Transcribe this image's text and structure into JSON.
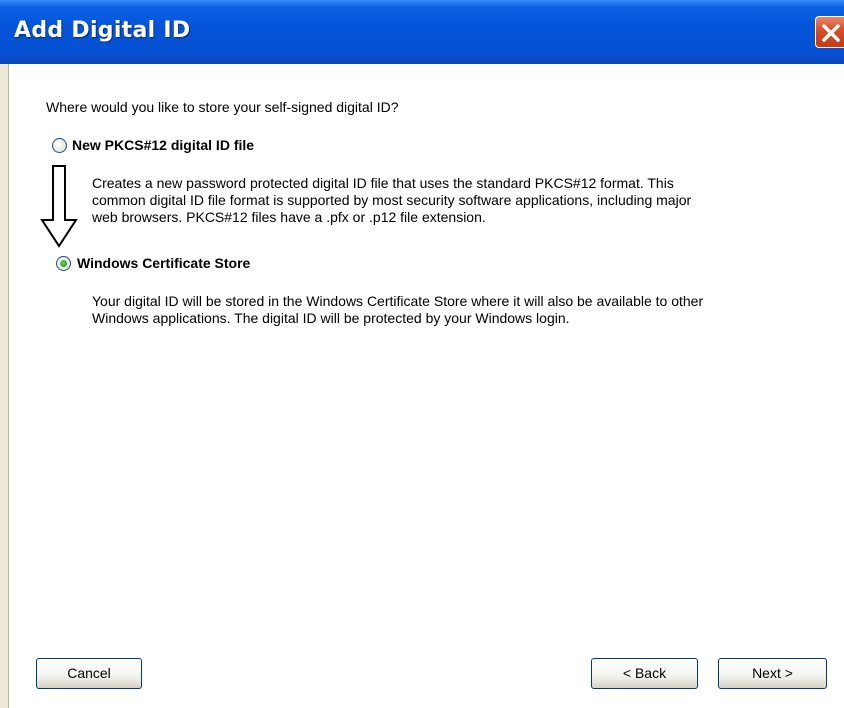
{
  "window": {
    "title": "Add Digital ID"
  },
  "dialog": {
    "prompt": "Where would you like to store your self-signed digital ID?",
    "options": [
      {
        "label": "New PKCS#12 digital ID file",
        "selected": false,
        "description_lines": [
          "Creates a new password protected digital ID file that uses the standard PKCS#12 format. This",
          "common digital ID file format is supported by most security software applications, including major",
          "web browsers. PKCS#12 files have a .pfx or .p12 file extension."
        ]
      },
      {
        "label": "Windows Certificate Store",
        "selected": true,
        "description_lines": [
          "Your digital ID will be stored in the Windows Certificate Store where it will also be available to other",
          "Windows applications. The digital ID will be protected by your Windows login."
        ]
      }
    ]
  },
  "buttons": {
    "cancel": "Cancel",
    "back": "< Back",
    "next": "Next >"
  },
  "colors": {
    "titlebar": "#0453d8",
    "close": "#d8502a",
    "radio_selected": "#2f9c1e"
  },
  "icons": {
    "close": "close-icon",
    "arrow": "down-arrow-icon"
  }
}
